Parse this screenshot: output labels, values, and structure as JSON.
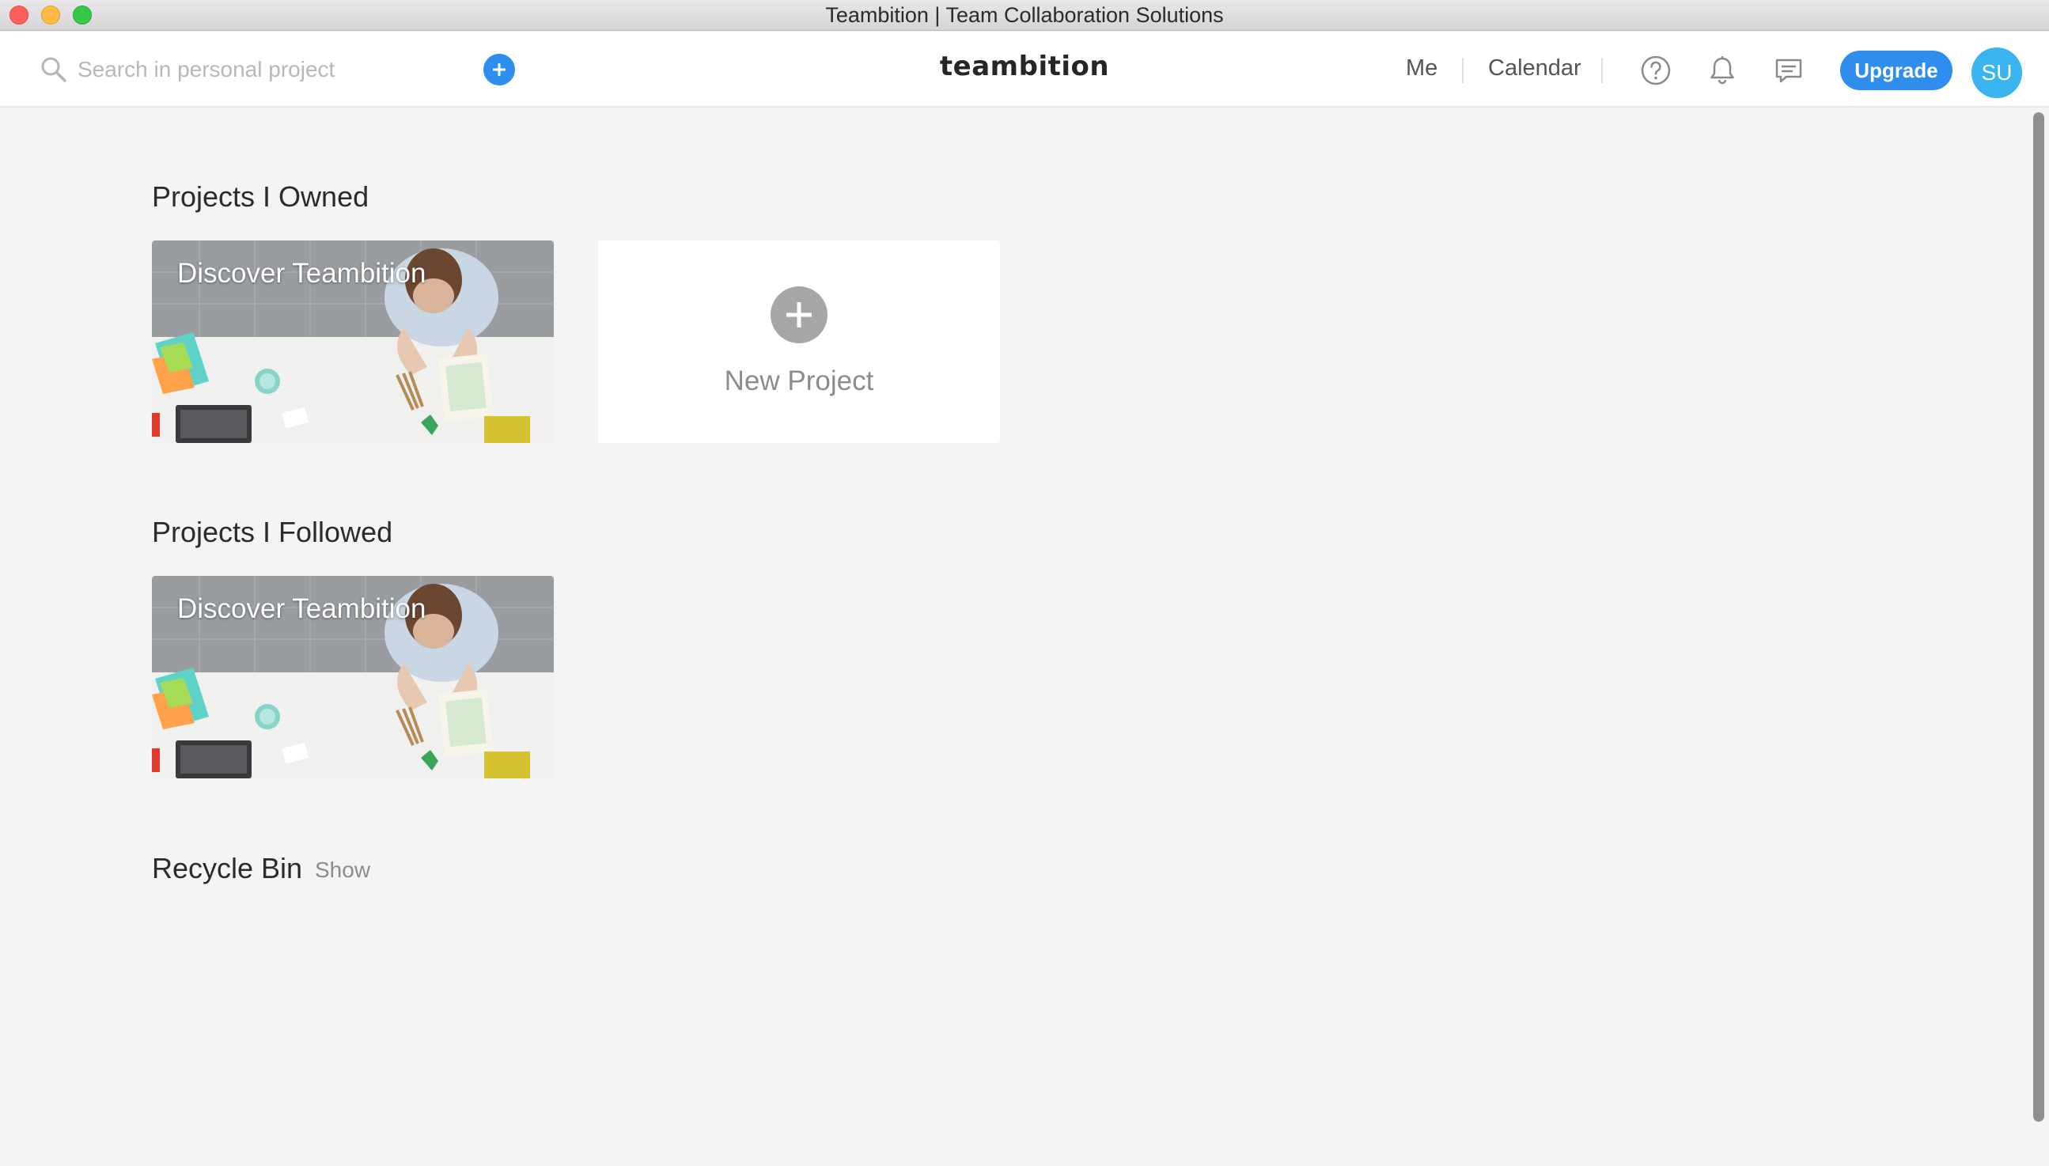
{
  "window": {
    "title": "Teambition | Team Collaboration Solutions"
  },
  "header": {
    "search_placeholder": "Search in personal project",
    "logo": "teambition",
    "nav": {
      "me": "Me",
      "calendar": "Calendar"
    },
    "icons": [
      "search-icon",
      "add-icon",
      "help-icon",
      "bell-icon",
      "chat-icon"
    ],
    "upgrade_label": "Upgrade",
    "avatar_initials": "SU"
  },
  "sections": {
    "owned": {
      "title": "Projects I Owned",
      "cards": [
        {
          "name": "Discover Teambition"
        }
      ],
      "new_project_label": "New Project"
    },
    "followed": {
      "title": "Projects I Followed",
      "cards": [
        {
          "name": "Discover Teambition"
        }
      ]
    },
    "recycle": {
      "title": "Recycle Bin",
      "show_label": "Show"
    }
  },
  "colors": {
    "accent": "#2f8ded",
    "avatar": "#3ab4ee",
    "background": "#f4f4f4"
  }
}
